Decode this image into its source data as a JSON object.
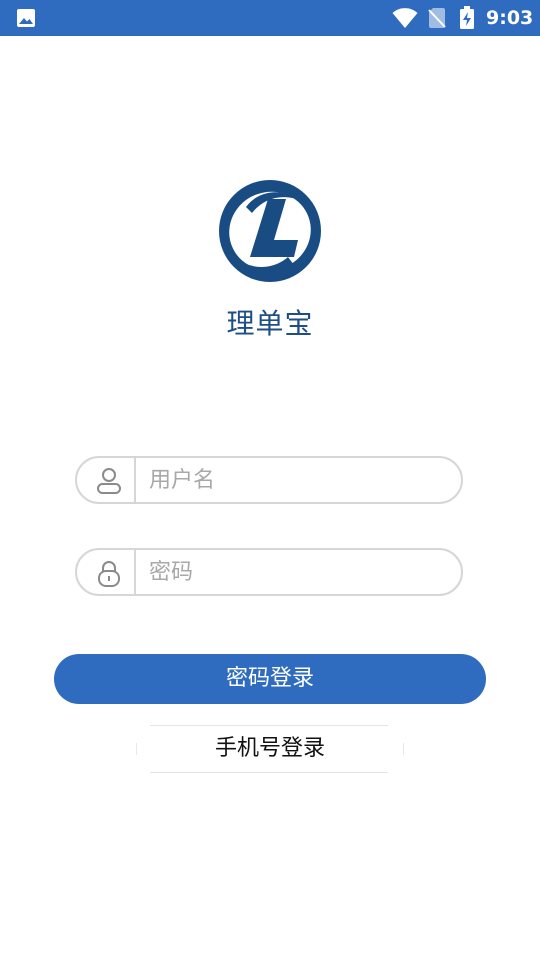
{
  "status_bar": {
    "time": "9:03",
    "icons": [
      "gallery-icon",
      "wifi-icon",
      "no-sim-icon",
      "battery-charging-icon"
    ],
    "background": "#2f6cbf"
  },
  "app": {
    "logo_icon": "logo-L-circle",
    "name": "理单宝",
    "brand_color": "#1f4e86"
  },
  "form": {
    "username": {
      "icon": "user-icon",
      "placeholder": "用户名",
      "value": ""
    },
    "password": {
      "icon": "lock-icon",
      "placeholder": "密码",
      "value": ""
    },
    "login_button_label": "密码登录",
    "phone_login_label": "手机号登录"
  },
  "colors": {
    "accent": "#2f6cbf",
    "field_border": "#d6d6d6",
    "placeholder": "#a8a8a8"
  }
}
